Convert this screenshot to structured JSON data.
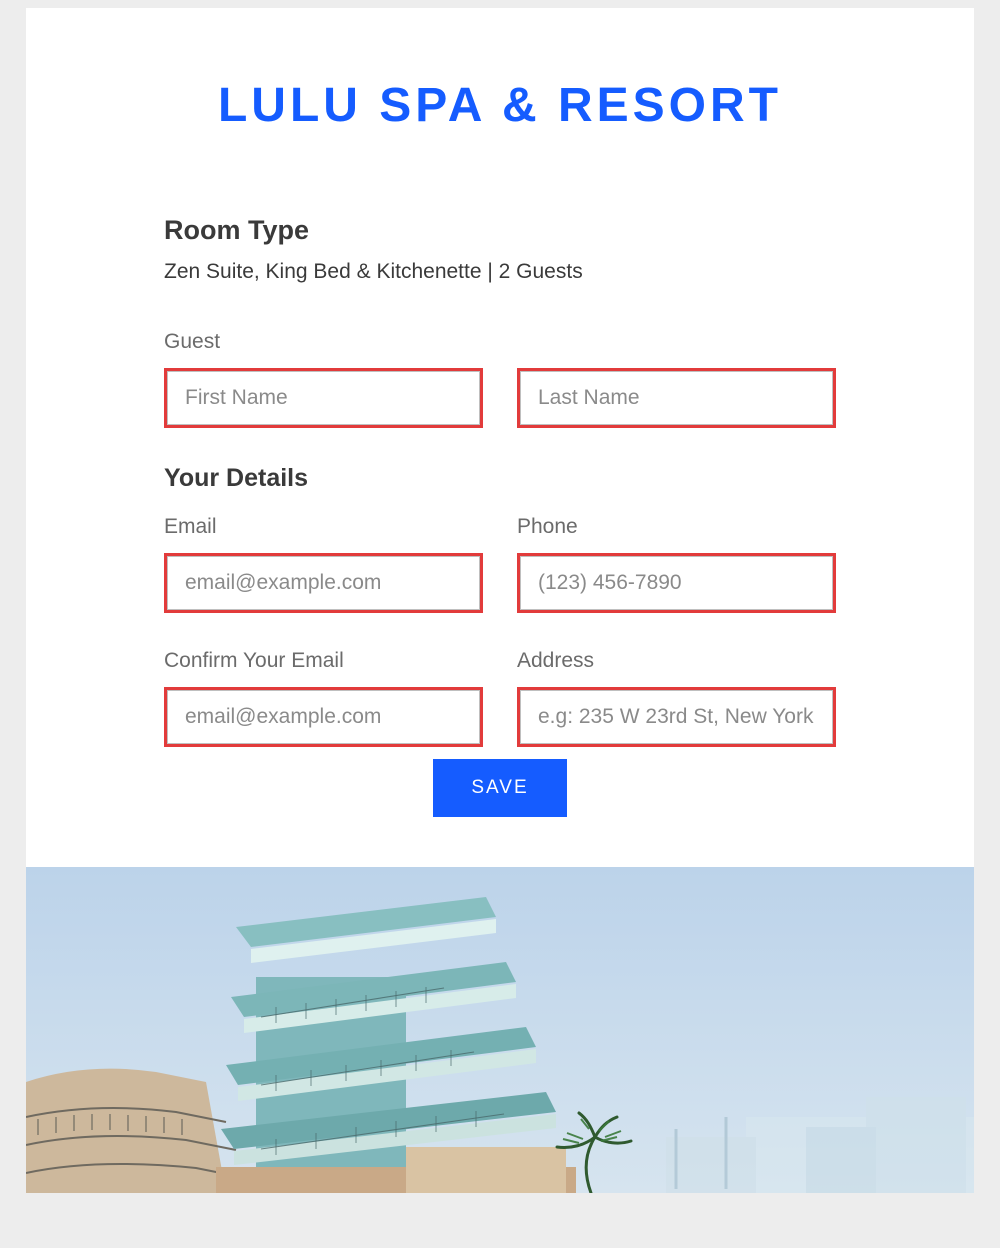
{
  "title": "LULU SPA & RESORT",
  "room_type": {
    "heading": "Room Type",
    "description": "Zen Suite, King Bed & Kitchenette | 2 Guests"
  },
  "guest": {
    "label": "Guest",
    "first_name_placeholder": "First Name",
    "last_name_placeholder": "Last Name"
  },
  "details": {
    "heading": "Your Details",
    "email_label": "Email",
    "email_placeholder": "email@example.com",
    "phone_label": "Phone",
    "phone_placeholder": "(123) 456-7890",
    "confirm_email_label": "Confirm Your Email",
    "confirm_email_placeholder": "email@example.com",
    "address_label": "Address",
    "address_placeholder": "e.g: 235 W 23rd St, New York"
  },
  "save_label": "SAVE",
  "colors": {
    "accent": "#155cff",
    "input_border": "#e23b3b"
  }
}
